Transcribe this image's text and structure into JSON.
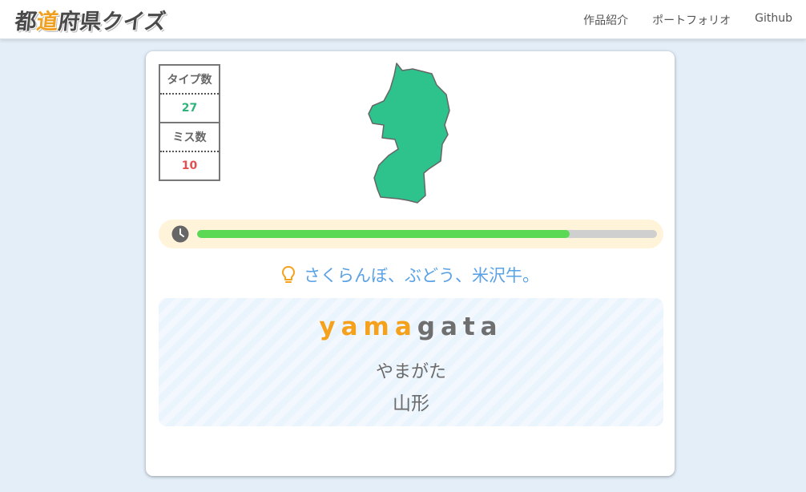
{
  "header": {
    "logo_part1": "都",
    "logo_accent": "道",
    "logo_part2": "府県クイズ",
    "nav": [
      {
        "label": "作品紹介"
      },
      {
        "label": "ポートフォリオ"
      },
      {
        "label": "Github"
      }
    ]
  },
  "stats": {
    "type_label": "タイプ数",
    "type_value": "27",
    "miss_label": "ミス数",
    "miss_value": "10"
  },
  "map": {
    "fill_color": "#2ec38c",
    "stroke_color": "#666666",
    "icon": "prefecture-shape"
  },
  "timer": {
    "icon": "clock-icon",
    "remaining_fraction": 0.81,
    "fill_color": "#5bd955",
    "track_color": "#cfcfcf"
  },
  "hint": {
    "icon": "lightbulb-icon",
    "text": "さくらんぼ、ぶどう、米沢牛。",
    "color": "#5aa2e6"
  },
  "answer": {
    "typed": "yama",
    "remaining": "gata",
    "kana": "やまがた",
    "kanji": "山形",
    "typed_color": "#f5a11c"
  }
}
